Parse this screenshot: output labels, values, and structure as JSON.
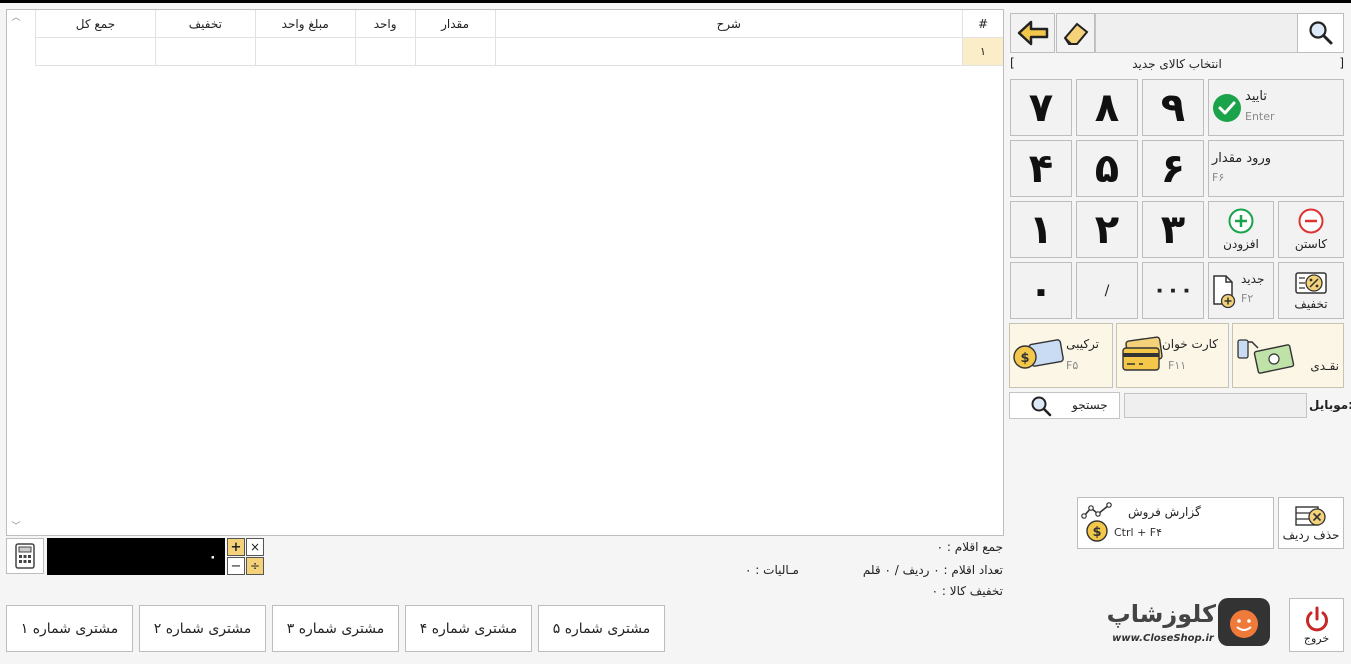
{
  "grid": {
    "columns": [
      "#",
      "شرح",
      "مقدار",
      "واحد",
      "مبلغ واحد",
      "تخفیف",
      "جمع کل"
    ],
    "rows": [
      {
        "index": "۱"
      }
    ]
  },
  "search": {
    "value": ""
  },
  "section_title": "انتخاب کالای جدید",
  "keypad": {
    "digits": [
      "۷",
      "۸",
      "۹",
      "۴",
      "۵",
      "۶",
      "۱",
      "۲",
      "۳",
      "۰",
      "/",
      "۰۰۰"
    ],
    "confirm_label": "تایید",
    "confirm_key": "Enter",
    "qty_label": "ورود مقدار",
    "qty_key": "F۶",
    "add_label": "افزودن",
    "sub_label": "کاستن",
    "new_label": "جدید",
    "new_key": "F۲",
    "discount_label": "تخفیف"
  },
  "payment": {
    "mixed_label": "ترکیبی",
    "mixed_key": "F۵",
    "card_label": "کارت خوان",
    "card_key": "F۱۱",
    "cash_label": "نقـدی"
  },
  "mobile": {
    "label": "موبایل:",
    "value": "",
    "search_label": "جستجو"
  },
  "report": {
    "label": "گزارش فروش",
    "key": "Ctrl + F۴"
  },
  "delete_row_label": "حذف ردیف",
  "exit_label": "خروج",
  "calculator": {
    "display": "۰",
    "ops": [
      "×",
      "+",
      "÷",
      "−"
    ]
  },
  "summary": {
    "items_total": "جمع اقلام : ۰",
    "items_count": "تعداد اقلام : ۰ ردیف / ۰ قلم",
    "tax": "مـالیات : ۰",
    "discount": "تخفیف کالا : ۰"
  },
  "customers": [
    "مشتری شماره ۵",
    "مشتری شماره ۴",
    "مشتری شماره ۳",
    "مشتری شماره ۲",
    "مشتری شماره ۱"
  ],
  "brand": {
    "name": "کلوزشاپ",
    "url": "www.CloseShop.ir"
  },
  "colors": {
    "accent_green": "#1aa34a",
    "pay_bg": "#fbf6e6",
    "display_bg": "#000000",
    "calc_yellow": "#f3d27a",
    "logo_orange": "#f07a3a"
  }
}
